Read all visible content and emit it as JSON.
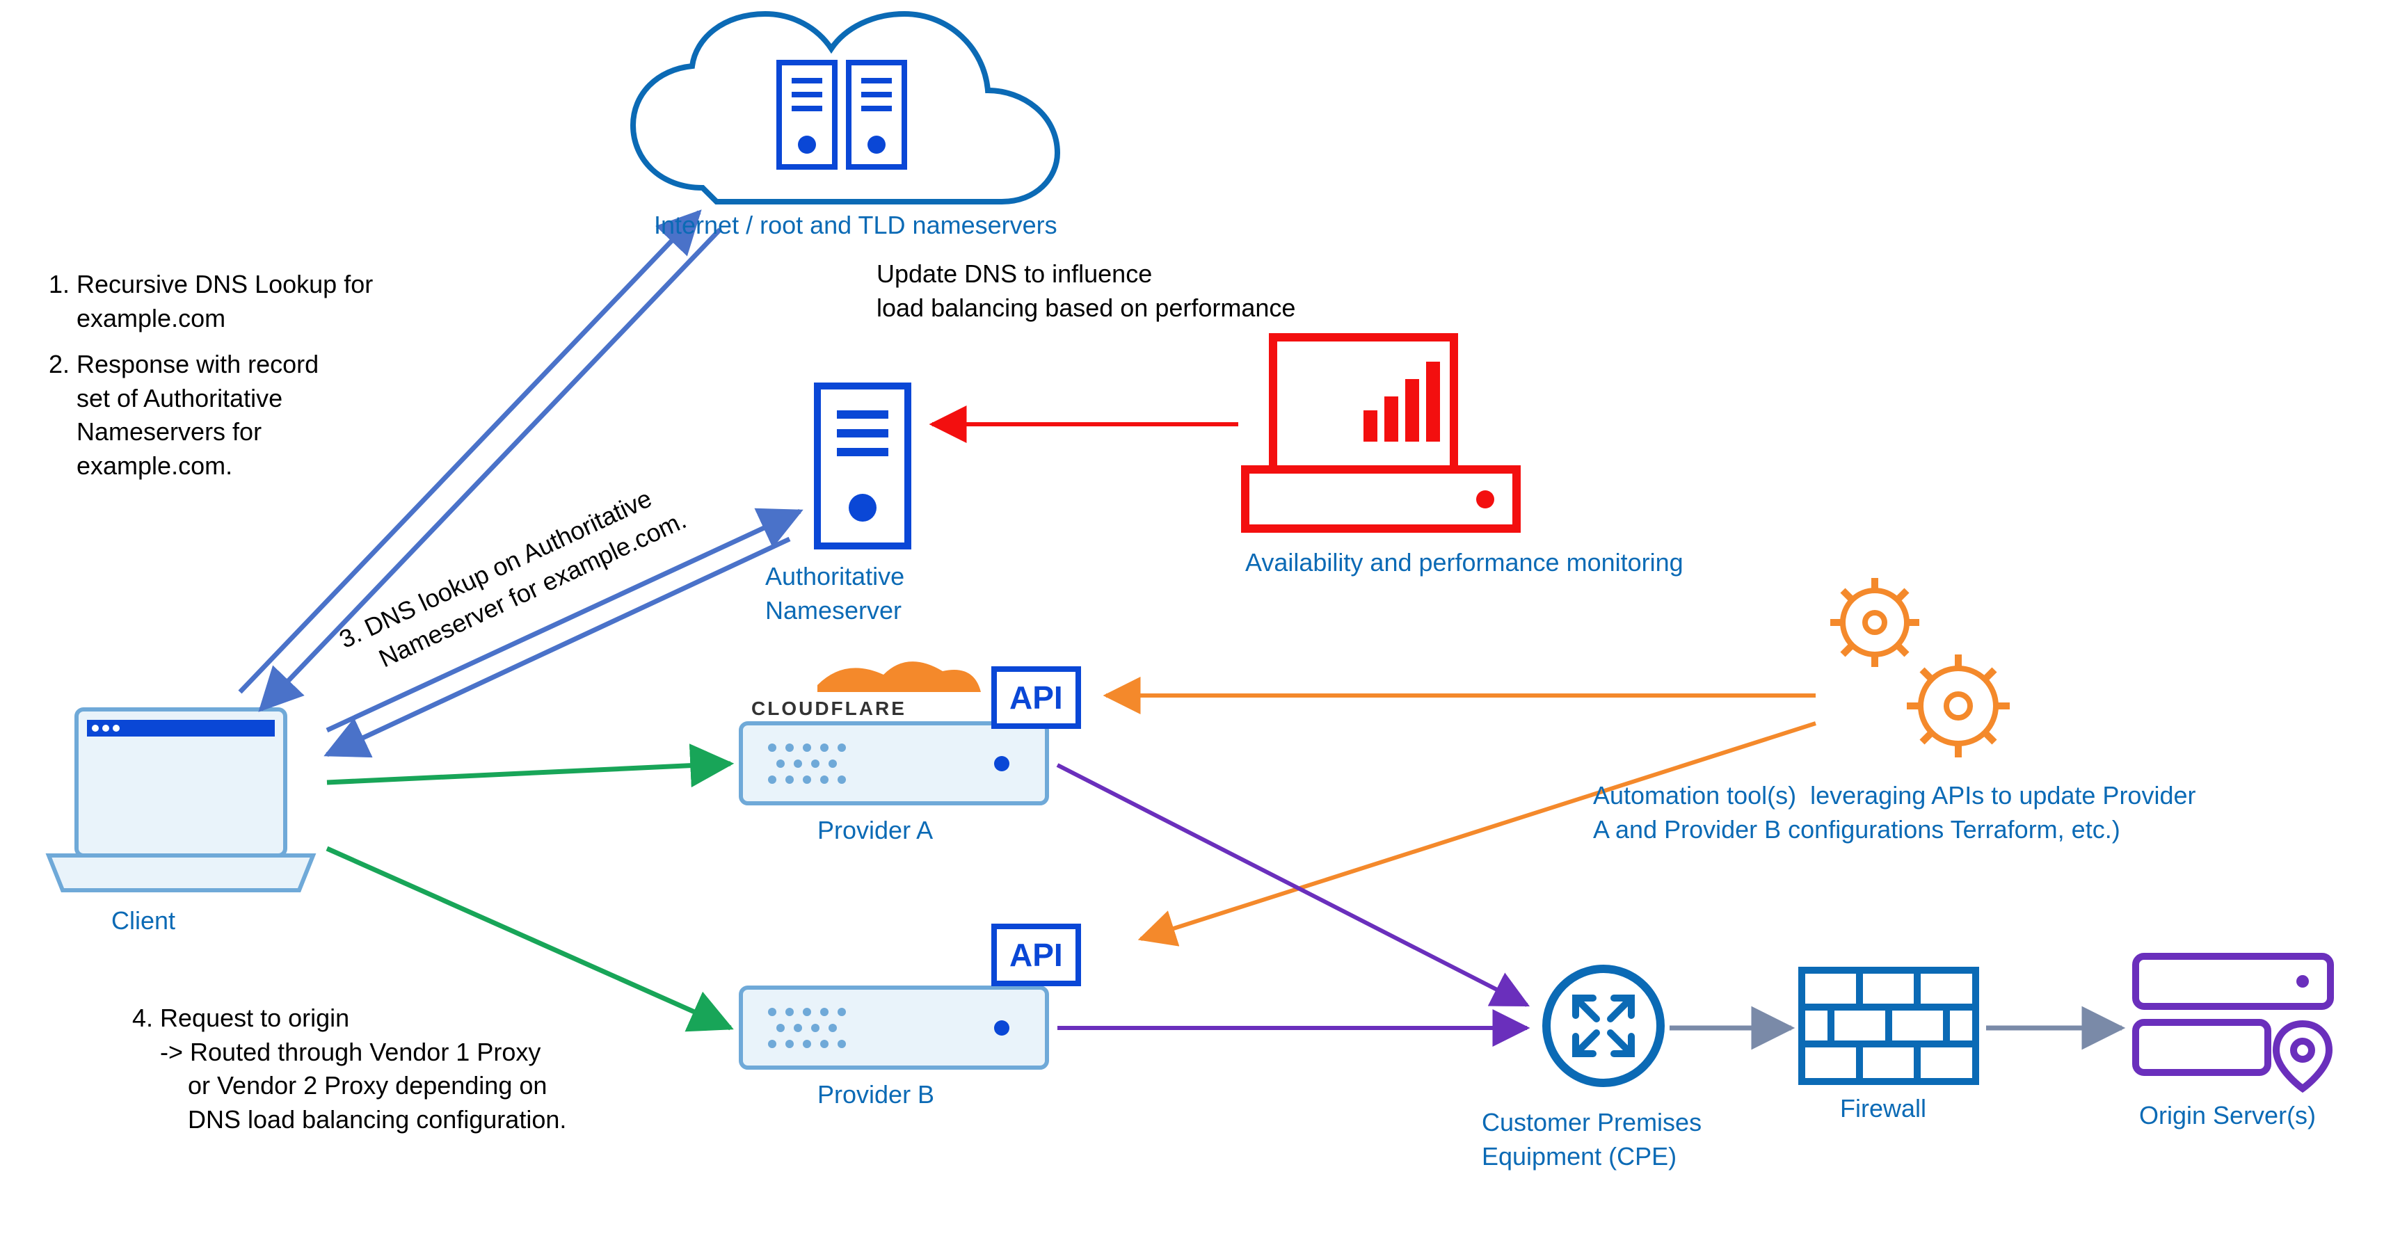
{
  "nodes": {
    "cloud": {
      "label": "Internet / root and TLD nameservers"
    },
    "client": {
      "label": "Client"
    },
    "authns": {
      "label": "Authoritative\nNameserver"
    },
    "monitor": {
      "label": "Availability and performance monitoring"
    },
    "providerA": {
      "label": "Provider A",
      "badge": "CLOUDFLARE",
      "api": "API"
    },
    "providerB": {
      "label": "Provider B",
      "api": "API"
    },
    "automation": {
      "label": "Automation tool(s)  leveraging APIs to update Provider\nA and Provider B configurations Terraform, etc.)"
    },
    "cpe": {
      "label": "Customer Premises\nEquipment (CPE)"
    },
    "firewall": {
      "label": "Firewall"
    },
    "origin": {
      "label": "Origin Server(s)"
    }
  },
  "annotations": {
    "step1": "1. Recursive DNS Lookup for\n    example.com",
    "step2": "2. Response with record\n    set of Authoritative\n    Nameservers for\n    example.com.",
    "step3": "3. DNS lookup on Authoritative\n    Nameserver for example.com.",
    "step4": "4. Request to origin\n    -> Routed through Vendor 1 Proxy\n        or Vendor 2 Proxy depending on\n        DNS load balancing configuration.",
    "updateDns": "Update DNS to influence\nload balancing based on performance"
  },
  "colors": {
    "blue": "#0b6ab5",
    "bluePath": "#4a72c9",
    "green": "#18a558",
    "red": "#f30f0f",
    "orange": "#f4892b",
    "purple": "#6a2fbc",
    "gray": "#7a8aa8"
  }
}
